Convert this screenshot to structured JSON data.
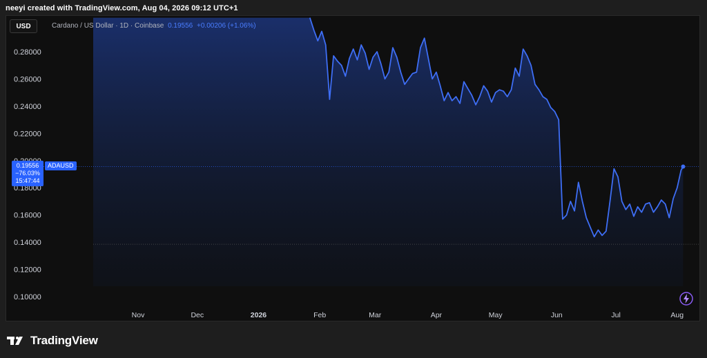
{
  "header": {
    "credit": "neeyi created with TradingView.com, Aug 04, 2026 09:12 UTC+1"
  },
  "toolbar": {
    "currency_label": "USD"
  },
  "legend": {
    "symbol_desc": "Cardano / US Dollar · 1D · Coinbase",
    "price": "0.19556",
    "change": "+0.00206 (+1.06%)"
  },
  "price_badge": {
    "price": "0.19556",
    "pct": "−76.03%",
    "countdown": "15:47:44",
    "symbol": "ADAUSD"
  },
  "branding": {
    "name": "TradingView"
  },
  "colors": {
    "line": "#3e6ef5",
    "accent": "#2962ff",
    "background": "#0f0f0f",
    "text": "#d1d4dc"
  },
  "chart_data": {
    "type": "area",
    "ylim": [
      0.095,
      0.305
    ],
    "y_ticks": [
      "0.28000",
      "0.26000",
      "0.24000",
      "0.22000",
      "0.20000",
      "0.18000",
      "0.16000",
      "0.14000",
      "0.12000",
      "0.10000"
    ],
    "x_ticks": [
      "Nov",
      "Dec",
      "2026",
      "Feb",
      "Mar",
      "Apr",
      "May",
      "Jun",
      "Jul",
      "Aug"
    ],
    "grid": false,
    "x": [
      "Oct 01",
      "Jan 27",
      "Jan 29",
      "Jan 31",
      "Feb 02",
      "Feb 04",
      "Feb 06",
      "Feb 08",
      "Feb 10",
      "Feb 12",
      "Feb 14",
      "Feb 16",
      "Feb 18",
      "Feb 20",
      "Feb 22",
      "Feb 24",
      "Feb 26",
      "Feb 28",
      "Mar 02",
      "Mar 04",
      "Mar 06",
      "Mar 08",
      "Mar 10",
      "Mar 12",
      "Mar 14",
      "Mar 16",
      "Mar 18",
      "Mar 20",
      "Mar 22",
      "Mar 24",
      "Mar 26",
      "Mar 28",
      "Mar 30",
      "Apr 01",
      "Apr 03",
      "Apr 05",
      "Apr 07",
      "Apr 09",
      "Apr 11",
      "Apr 13",
      "Apr 15",
      "Apr 17",
      "Apr 19",
      "Apr 21",
      "Apr 23",
      "Apr 25",
      "Apr 27",
      "Apr 29",
      "May 01",
      "May 03",
      "May 05",
      "May 07",
      "May 09",
      "May 11",
      "May 13",
      "May 15",
      "May 17",
      "May 19",
      "May 21",
      "May 23",
      "May 25",
      "May 27",
      "May 29",
      "May 31",
      "Jun 02",
      "Jun 04",
      "Jun 06",
      "Jun 08",
      "Jun 10",
      "Jun 12",
      "Jun 14",
      "Jun 16",
      "Jun 18",
      "Jun 20",
      "Jun 22",
      "Jun 24",
      "Jun 26",
      "Jun 28",
      "Jun 30",
      "Jul 02",
      "Jul 04",
      "Jul 06",
      "Jul 08",
      "Jul 10",
      "Jul 12",
      "Jul 14",
      "Jul 16",
      "Jul 18",
      "Jul 20",
      "Jul 22",
      "Jul 24",
      "Jul 26",
      "Jul 28",
      "Jul 30",
      "Aug 01",
      "Aug 03",
      "Aug 04"
    ],
    "values": [
      0.305,
      0.305,
      0.296,
      0.288,
      0.295,
      0.285,
      0.245,
      0.277,
      0.273,
      0.27,
      0.262,
      0.275,
      0.282,
      0.274,
      0.285,
      0.279,
      0.267,
      0.276,
      0.28,
      0.271,
      0.26,
      0.265,
      0.283,
      0.276,
      0.265,
      0.256,
      0.26,
      0.264,
      0.265,
      0.283,
      0.29,
      0.275,
      0.26,
      0.265,
      0.255,
      0.244,
      0.25,
      0.244,
      0.247,
      0.242,
      0.258,
      0.253,
      0.248,
      0.241,
      0.247,
      0.255,
      0.251,
      0.243,
      0.25,
      0.252,
      0.251,
      0.247,
      0.252,
      0.268,
      0.262,
      0.282,
      0.277,
      0.27,
      0.256,
      0.252,
      0.247,
      0.245,
      0.239,
      0.236,
      0.23,
      0.157,
      0.16,
      0.17,
      0.163,
      0.184,
      0.17,
      0.158,
      0.151,
      0.144,
      0.149,
      0.145,
      0.148,
      0.17,
      0.194,
      0.188,
      0.17,
      0.164,
      0.168,
      0.159,
      0.166,
      0.162,
      0.168,
      0.169,
      0.162,
      0.166,
      0.171,
      0.168,
      0.158,
      0.172,
      0.18,
      0.193,
      0.1956
    ]
  }
}
